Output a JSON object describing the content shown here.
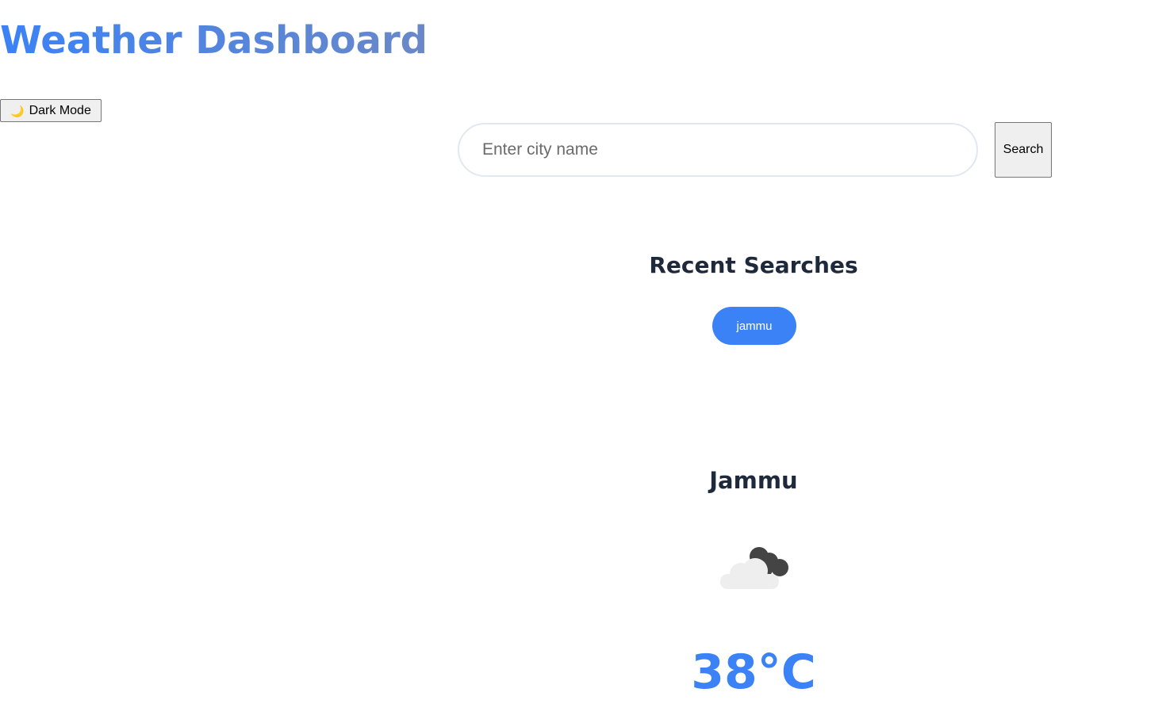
{
  "header": {
    "title": "Weather Dashboard"
  },
  "theme_toggle": {
    "icon": "moon-icon",
    "icon_glyph": "🌙",
    "label": "Dark Mode"
  },
  "search": {
    "placeholder": "Enter city name",
    "value": "",
    "button_label": "Search"
  },
  "recent_searches": {
    "heading": "Recent Searches",
    "items": [
      "jammu"
    ]
  },
  "current_weather": {
    "city": "Jammu",
    "condition_icon": "broken-clouds-icon",
    "temperature": "38°C"
  },
  "colors": {
    "accent": "#3b82f6",
    "heading_text": "#1e293b",
    "input_border": "#e2e8f0"
  }
}
